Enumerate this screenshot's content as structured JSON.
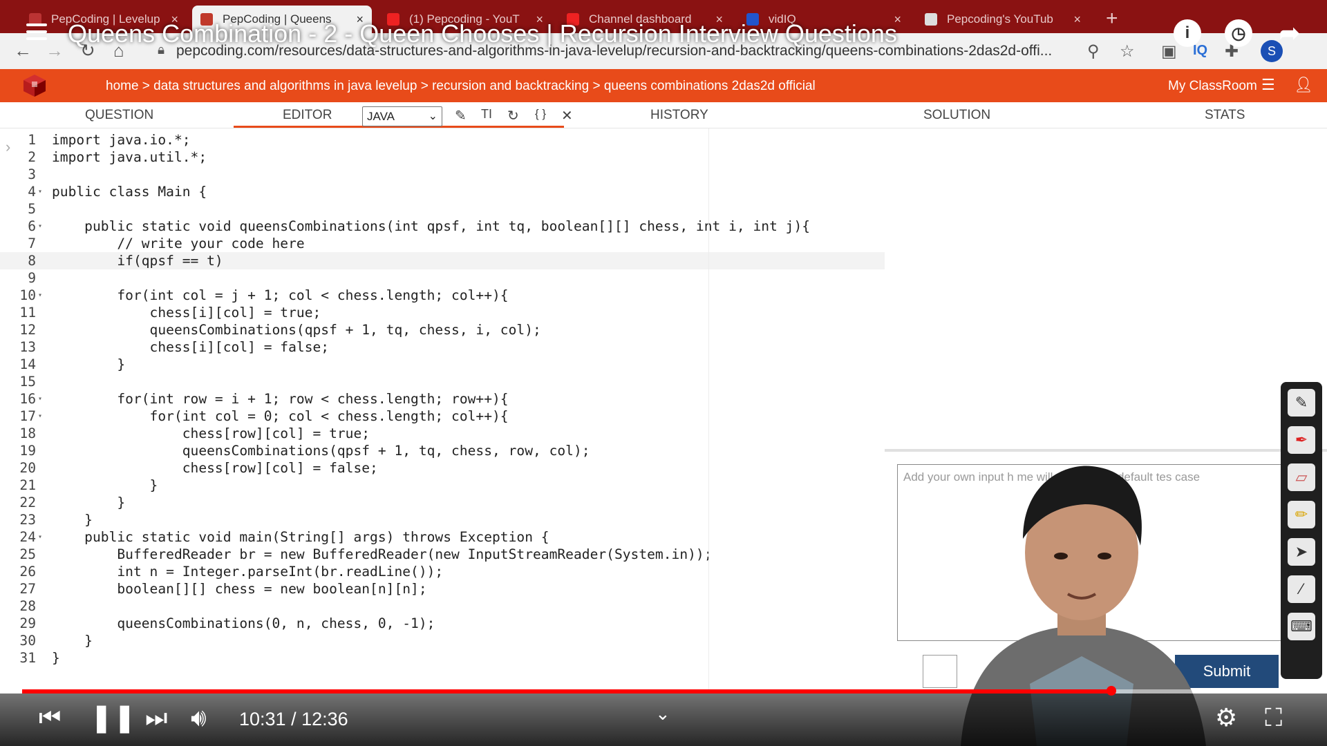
{
  "browser": {
    "tabs": [
      {
        "label": "PepCoding | Levelup",
        "active": false
      },
      {
        "label": "PepCoding | Queens",
        "active": true
      },
      {
        "label": "(1) Pepcoding - YouT",
        "active": false
      },
      {
        "label": "Channel dashboard",
        "active": false
      },
      {
        "label": "vidIQ",
        "active": false
      },
      {
        "label": "Pepcoding's YouTub",
        "active": false
      }
    ],
    "url": "pepcoding.com/resources/data-structures-and-algorithms-in-java-levelup/recursion-and-backtracking/queens-combinations-2das2d-offi..."
  },
  "video": {
    "title": "Queens Combination - 2 - Queen Chooses | Recursion Interview Questions",
    "time": "10:31 / 12:36",
    "progress": 0.849
  },
  "site": {
    "breadcrumb": "home > data structures and algorithms in java levelup > recursion and backtracking > queens combinations 2das2d official",
    "my_classroom": "My ClassRoom"
  },
  "panel_tabs": {
    "question": "QUESTION",
    "editor": "EDITOR",
    "history": "HISTORY",
    "solution": "SOLUTION",
    "stats": "STATS"
  },
  "language": "JAVA",
  "editor": {
    "active_line": 8,
    "lines": [
      {
        "n": "1",
        "code": "import java.io.*;",
        "fold": false
      },
      {
        "n": "2",
        "code": "import java.util.*;",
        "fold": false
      },
      {
        "n": "3",
        "code": "",
        "fold": false
      },
      {
        "n": "4",
        "code": "public class Main {",
        "fold": true
      },
      {
        "n": "5",
        "code": "",
        "fold": false
      },
      {
        "n": "6",
        "code": "    public static void queensCombinations(int qpsf, int tq, boolean[][] chess, int i, int j){",
        "fold": true
      },
      {
        "n": "7",
        "code": "        // write your code here",
        "fold": false
      },
      {
        "n": "8",
        "code": "        if(qpsf == t)",
        "fold": false
      },
      {
        "n": "9",
        "code": "",
        "fold": false
      },
      {
        "n": "10",
        "code": "        for(int col = j + 1; col < chess.length; col++){",
        "fold": true
      },
      {
        "n": "11",
        "code": "            chess[i][col] = true;",
        "fold": false
      },
      {
        "n": "12",
        "code": "            queensCombinations(qpsf + 1, tq, chess, i, col);",
        "fold": false
      },
      {
        "n": "13",
        "code": "            chess[i][col] = false;",
        "fold": false
      },
      {
        "n": "14",
        "code": "        }",
        "fold": false
      },
      {
        "n": "15",
        "code": "",
        "fold": false
      },
      {
        "n": "16",
        "code": "        for(int row = i + 1; row < chess.length; row++){",
        "fold": true
      },
      {
        "n": "17",
        "code": "            for(int col = 0; col < chess.length; col++){",
        "fold": true
      },
      {
        "n": "18",
        "code": "                chess[row][col] = true;",
        "fold": false
      },
      {
        "n": "19",
        "code": "                queensCombinations(qpsf + 1, tq, chess, row, col);",
        "fold": false
      },
      {
        "n": "20",
        "code": "                chess[row][col] = false;",
        "fold": false
      },
      {
        "n": "21",
        "code": "            }",
        "fold": false
      },
      {
        "n": "22",
        "code": "        }",
        "fold": false
      },
      {
        "n": "23",
        "code": "    }",
        "fold": false
      },
      {
        "n": "24",
        "code": "    public static void main(String[] args) throws Exception {",
        "fold": true
      },
      {
        "n": "25",
        "code": "        BufferedReader br = new BufferedReader(new InputStreamReader(System.in));",
        "fold": false
      },
      {
        "n": "26",
        "code": "        int n = Integer.parseInt(br.readLine());",
        "fold": false
      },
      {
        "n": "27",
        "code": "        boolean[][] chess = new boolean[n][n];",
        "fold": false
      },
      {
        "n": "28",
        "code": "",
        "fold": false
      },
      {
        "n": "29",
        "code": "        queensCombinations(0, n, chess, 0, -1);",
        "fold": false
      },
      {
        "n": "30",
        "code": "    }",
        "fold": false
      },
      {
        "n": "31",
        "code": "}",
        "fold": false
      }
    ]
  },
  "custom_input": {
    "placeholder": "Add your own input h                  me will run against default tes case"
  },
  "submit_label": "Submit",
  "colors": {
    "site_orange": "#e84b1a",
    "tabstrip": "#8a1212",
    "progress": "#ff0000"
  }
}
